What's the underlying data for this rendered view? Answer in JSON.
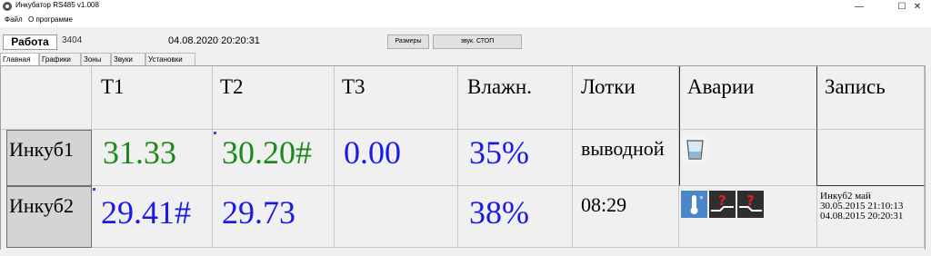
{
  "window": {
    "title": "Инкубатор RS485  v1.008",
    "minimize": "—",
    "maximize": "☐",
    "close": "✕"
  },
  "menu": [
    "Файл",
    "О программе"
  ],
  "toolbar": {
    "mode": "Работа",
    "counter": "3404",
    "datetime": "04.08.2020 20:20:31",
    "sizes_button": "Размеры",
    "sound_stop_button": "звук. СТОП"
  },
  "tabs": [
    "Главная",
    "Графики",
    "Зоны",
    "Звуки",
    "Установки"
  ],
  "table": {
    "headers": [
      "T1",
      "T2",
      "T3",
      "Влажн.",
      "Лотки",
      "Аварии",
      "Запись"
    ],
    "rows": [
      {
        "label": "Инкуб1",
        "t1": "31.33",
        "t2": "30.20#",
        "t3": "0.00",
        "humidity": "35%",
        "trays": "выводной",
        "alarms": [
          "water-glass-icon"
        ],
        "record": []
      },
      {
        "label": "Инкуб2",
        "t1": "29.41#",
        "t2": "29.73",
        "t3": "",
        "humidity": "38%",
        "trays": "08:29",
        "alarms": [
          "temperature-low-icon",
          "tray-unknown-icon",
          "tray-unknown-icon"
        ],
        "record": [
          "Инкуб2  май",
          "30.05.2015 21:10:13",
          "04.08.2015 20:20:31"
        ]
      }
    ]
  },
  "colors": {
    "green_value": "#1b8a1b",
    "blue_value": "#1a1ae6",
    "alarm_blue": "#4a86c8",
    "alarm_dark": "#2e2e2e",
    "alarm_red": "#e02020"
  }
}
